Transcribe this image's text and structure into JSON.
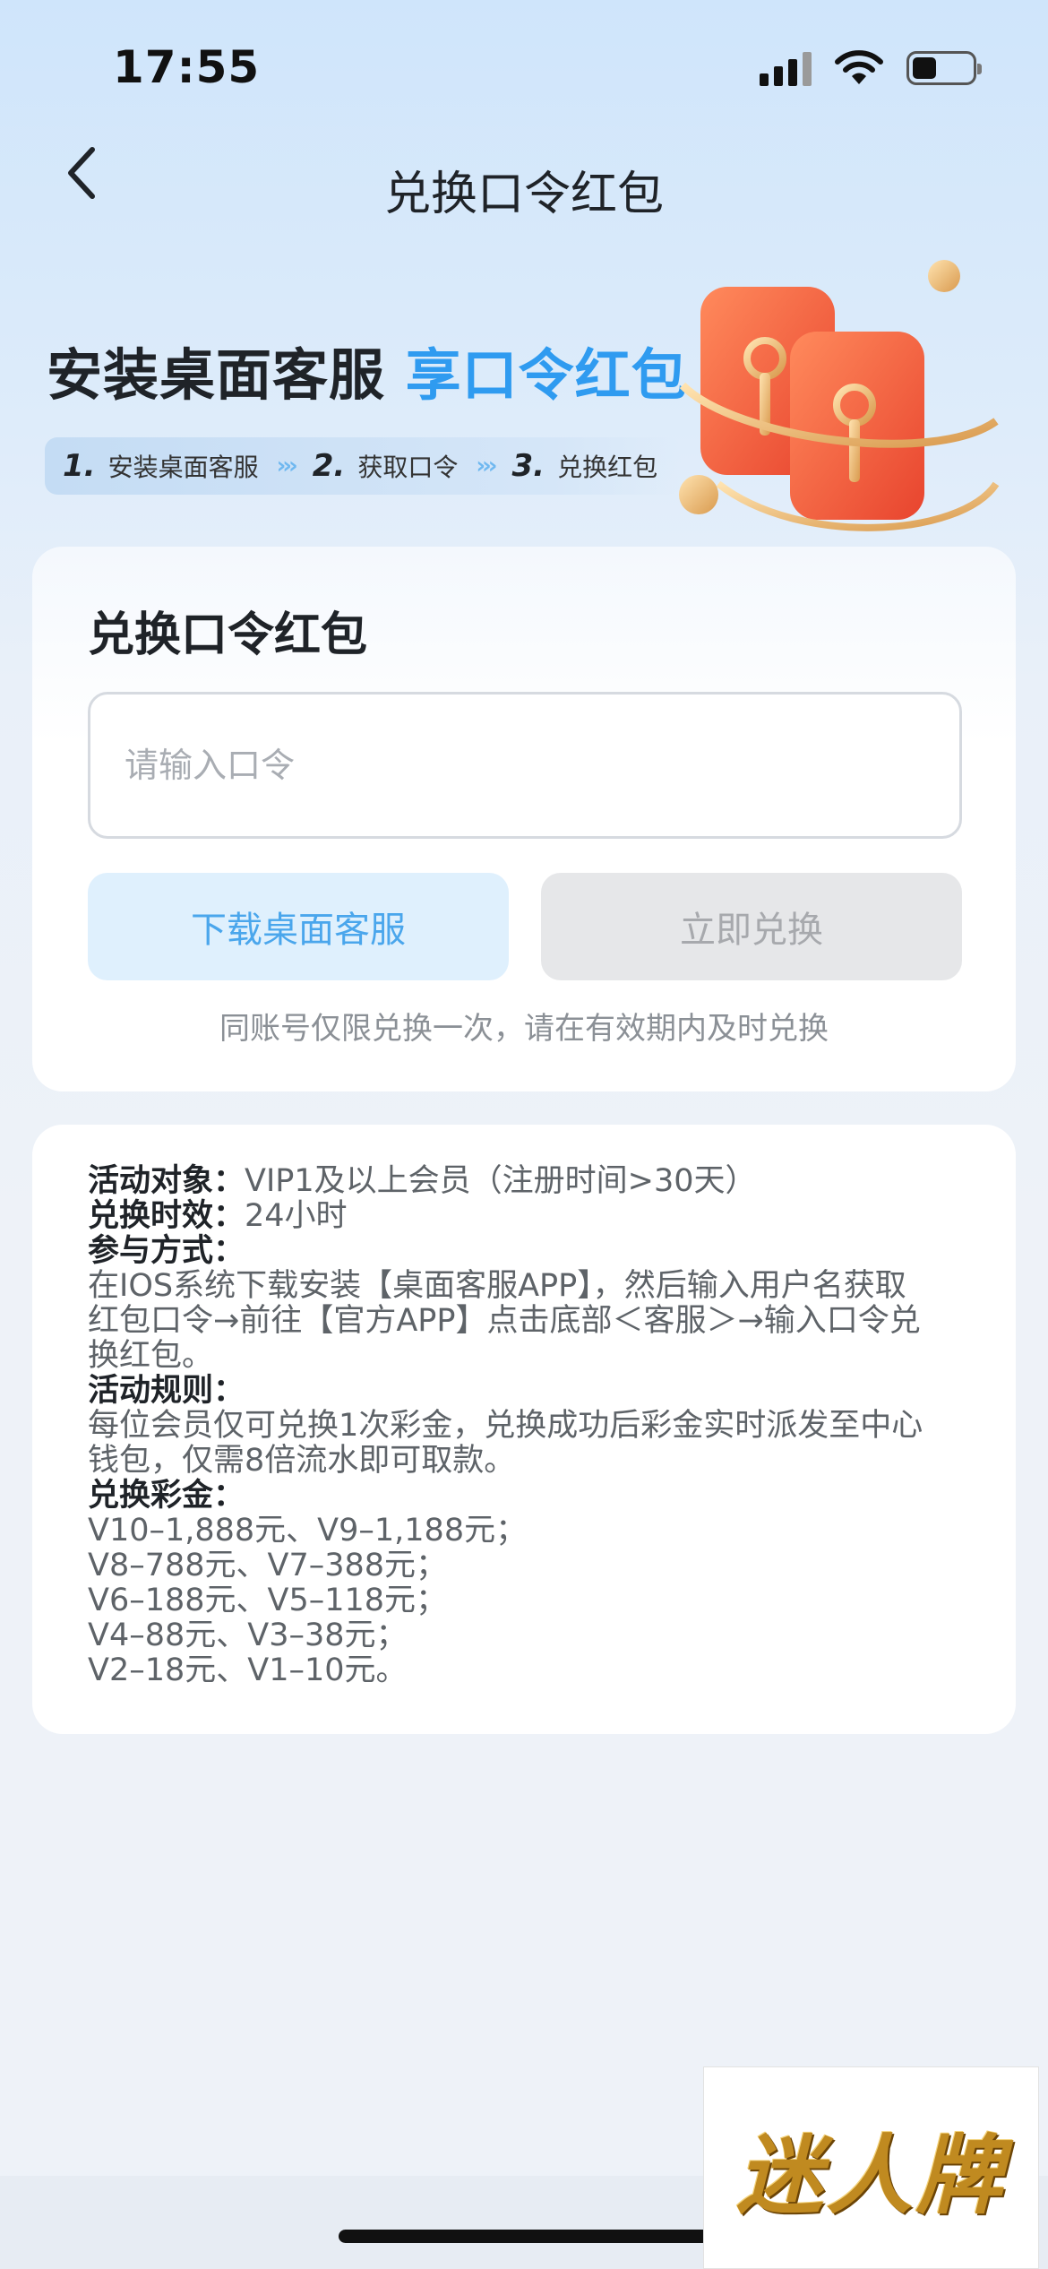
{
  "status_bar": {
    "time": "17:55"
  },
  "nav": {
    "title": "兑换口令红包"
  },
  "banner": {
    "headline_main": "安装桌面客服",
    "headline_highlight": "享口令红包",
    "steps": [
      {
        "num": "1.",
        "label": "安装桌面客服"
      },
      {
        "num": "2.",
        "label": "获取口令"
      },
      {
        "num": "3.",
        "label": "兑换红包"
      }
    ],
    "arrow": "›››"
  },
  "redeem": {
    "title": "兑换口令红包",
    "input_placeholder": "请输入口令",
    "input_value": "",
    "download_label": "下载桌面客服",
    "redeem_label": "立即兑换",
    "notice": "同账号仅限兑换一次，请在有效期内及时兑换"
  },
  "rules": {
    "target_label": "活动对象：",
    "target_value": "VIP1及以上会员（注册时间>30天）",
    "validity_label": "兑换时效：",
    "validity_value": "24小时",
    "method_label": "参与方式：",
    "method_lines": [
      "在IOS系统下载安装【桌面客服APP】，然后输入用户名获取",
      "红包口令→前往【官方APP】点击底部＜客服＞→输入口令兑",
      "换红包。"
    ],
    "rules_label": "活动规则：",
    "rules_lines": [
      "每位会员仅可兑换1次彩金，兑换成功后彩金实时派发至中心",
      "钱包，仅需8倍流水即可取款。"
    ],
    "bonus_label": "兑换彩金：",
    "bonus_lines": [
      "V10–1,888元、V9–1,188元；",
      "V8–788元、V7–388元；",
      "V6–188元、V5–118元；",
      "V4–88元、V3–38元；",
      "V2–18元、V1–10元。"
    ]
  },
  "watermark": {
    "text": "迷人牌"
  },
  "icons": {
    "back": "chevron-left-icon",
    "signal": "cellular-signal-icon",
    "wifi": "wifi-icon",
    "battery": "battery-icon"
  },
  "colors": {
    "accent": "#2f9bf0",
    "download_bg": "#dff0fd",
    "download_text": "#4aa6ec",
    "redeem_disabled_bg": "#e6e7e9",
    "envelope": "#f0553a"
  }
}
